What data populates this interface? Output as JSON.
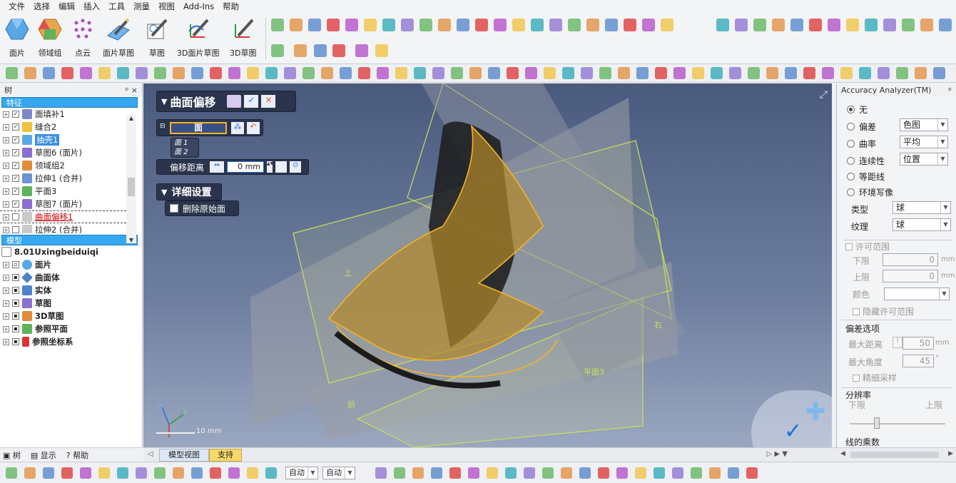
{
  "menu": [
    "文件",
    "选择",
    "编辑",
    "插入",
    "工具",
    "测量",
    "视图",
    "Add-Ins",
    "帮助"
  ],
  "ribbon": {
    "buttons": [
      "面片",
      "领域组",
      "点云",
      "面片草图",
      "草图",
      "3D面片草图",
      "3D草图"
    ]
  },
  "tree_panel": {
    "title": "树",
    "pin": "ᵖ ×",
    "features_header": "特征",
    "features": [
      {
        "label": "面填补1",
        "state": "normal"
      },
      {
        "label": "缝合2",
        "state": "normal"
      },
      {
        "label": "抽壳1",
        "state": "selected"
      },
      {
        "label": "草图6 (面片)",
        "state": "normal"
      },
      {
        "label": "领域组2",
        "state": "normal"
      },
      {
        "label": "拉伸1 (合并)",
        "state": "normal"
      },
      {
        "label": "平面3",
        "state": "normal"
      },
      {
        "label": "草图7 (面片)",
        "state": "normal"
      },
      {
        "label": "曲面偏移1",
        "state": "error"
      },
      {
        "label": "拉伸2 (合并)",
        "state": "normal"
      }
    ],
    "model_header": "模型",
    "model_root": "8.01Uxingbeiduiqi",
    "model_items": [
      "面片",
      "曲面体",
      "实体",
      "草图",
      "3D草图",
      "参照平面",
      "参照坐标系"
    ],
    "bottom_tabs": [
      "树",
      "显示",
      "帮助"
    ]
  },
  "dialog": {
    "title": "曲面偏移",
    "face_label": "面",
    "faces": [
      "面 1",
      "面 2"
    ],
    "offset_label": "偏移距离",
    "offset_value": "0 mm",
    "detail_title": "详细设置",
    "delete_original": "删除原始面"
  },
  "viewport": {
    "plane_labels": [
      "上",
      "右",
      "前",
      "平面3"
    ],
    "scale_label": "10 mm",
    "tabs": [
      "模型视图",
      "支持"
    ]
  },
  "accuracy_panel": {
    "title": "Accuracy Analyzer(TM)",
    "modes": [
      "无",
      "偏差",
      "曲率",
      "连续性",
      "等距线",
      "环境写像"
    ],
    "selected_mode": "无",
    "deviation_value": "色图",
    "curvature_value": "平均",
    "continuity_value": "位置",
    "type_label": "类型",
    "type_value": "球",
    "texture_label": "纹理",
    "texture_value": "球",
    "tolerance_title": "许可范围",
    "lower_label": "下限",
    "lower_value": "0",
    "upper_label": "上限",
    "upper_value": "0",
    "unit": "mm",
    "color_label": "颜色",
    "hide_tolerance": "隐藏许可范围",
    "deviation_options_title": "偏差选项",
    "max_distance_label": "最大距离",
    "max_distance_value": "50",
    "max_angle_label": "最大角度",
    "max_angle_value": "45",
    "degree_symbol": "°",
    "fine_sampling": "精细采样",
    "resolution_title": "分辨率",
    "res_lower": "下限",
    "res_upper": "上限",
    "multiplier_title": "线的乘数"
  },
  "statusbar": {
    "dropdown1": "自动",
    "dropdown2": "自动"
  }
}
